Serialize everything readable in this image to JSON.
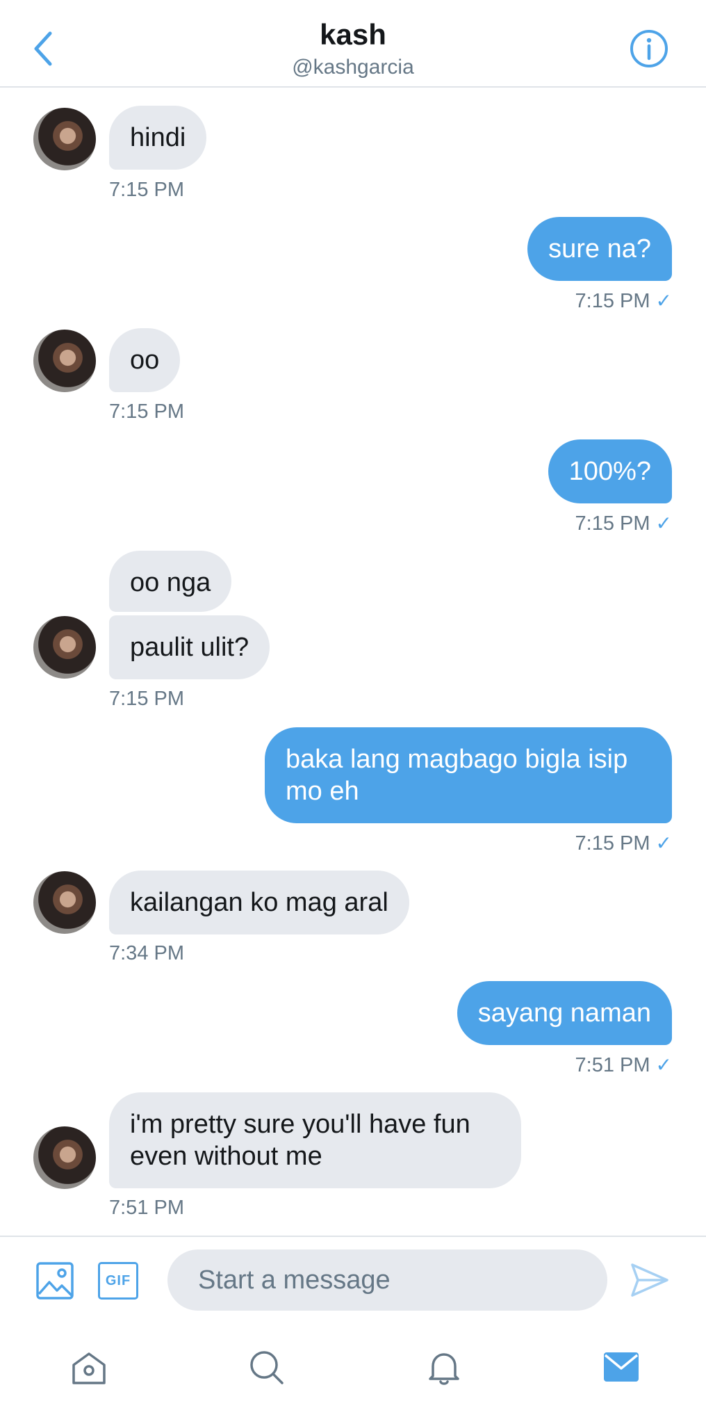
{
  "header": {
    "name": "kash",
    "handle": "@kashgarcia",
    "back_icon": "chevron-left-icon",
    "info_icon": "info-icon"
  },
  "messages": [
    {
      "from": "them",
      "text": "hindi",
      "time": "7:15 PM"
    },
    {
      "from": "me",
      "text": "sure na?",
      "time": "7:15 PM"
    },
    {
      "from": "them",
      "text": "oo",
      "time": "7:15 PM"
    },
    {
      "from": "me",
      "text": "100%?",
      "time": "7:15 PM"
    },
    {
      "from": "them",
      "text": "oo nga",
      "time": ""
    },
    {
      "from": "them",
      "text": "paulit ulit?",
      "time": "7:15 PM"
    },
    {
      "from": "me",
      "text": "baka lang magbago bigla isip mo eh",
      "time": "7:15 PM"
    },
    {
      "from": "them",
      "text": "kailangan ko mag aral",
      "time": "7:34 PM"
    },
    {
      "from": "me",
      "text": "sayang naman",
      "time": "7:51 PM"
    },
    {
      "from": "them",
      "text": "i'm pretty sure you'll have fun even without me",
      "time": "7:51 PM"
    }
  ],
  "read_check": "✓",
  "composer": {
    "placeholder": "Start a message",
    "gif_label": "GIF"
  },
  "colors": {
    "accent": "#4da3e8",
    "received_bubble": "#e6e9ee",
    "meta_text": "#657786"
  }
}
